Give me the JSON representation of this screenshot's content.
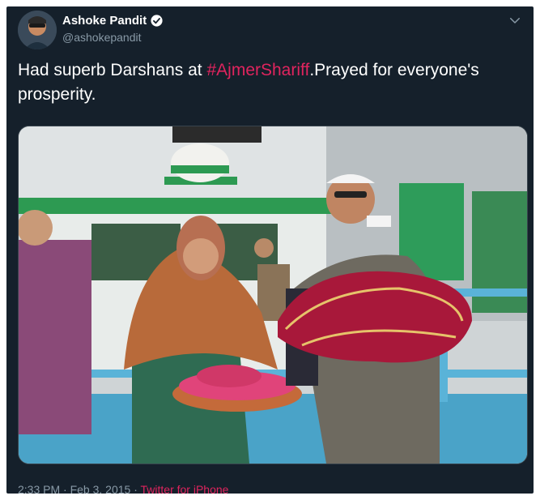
{
  "author": {
    "display_name": "Ashoke Pandit",
    "handle": "@ashokepandit",
    "verified": true
  },
  "tweet": {
    "text_before": "Had superb Darshans at ",
    "hashtag": "#AjmerShariff",
    "text_after": ".Prayed for everyone's prosperity."
  },
  "meta": {
    "timestamp": "2:33 PM · Feb 3, 2015 · ",
    "source": "Twitter for iPhone"
  },
  "icons": {
    "verified": "verified-badge-icon",
    "caret": "chevron-down-icon"
  },
  "colors": {
    "background": "#15202b",
    "link": "#e0245e",
    "secondary_text": "#8899a6"
  }
}
